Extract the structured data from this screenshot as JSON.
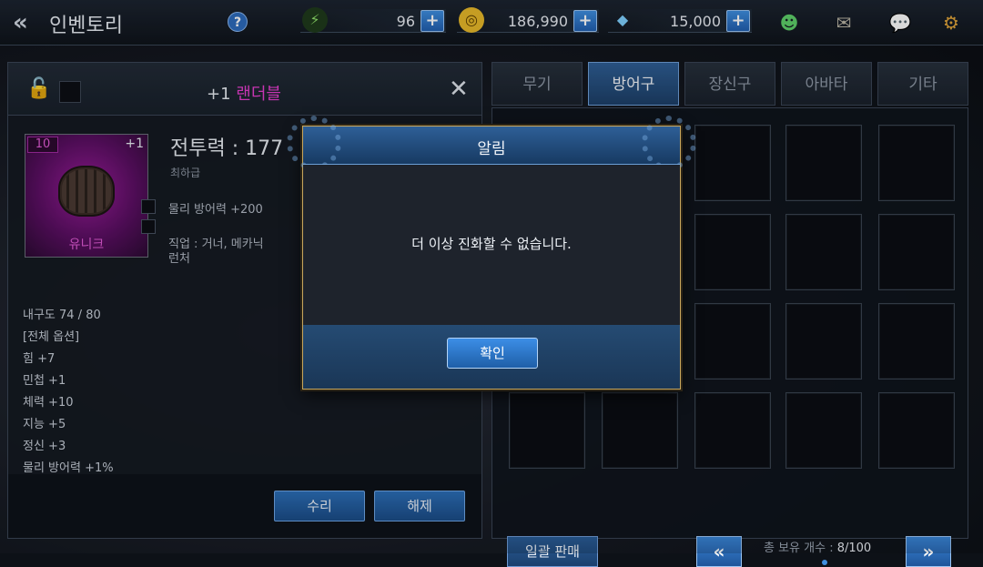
{
  "header": {
    "title": "인벤토리",
    "help": "?",
    "energy": "96",
    "gold": "186,990",
    "gems": "15,000",
    "plus": "+"
  },
  "item_panel": {
    "enhance": "+1",
    "name": "랜더블",
    "level": "10",
    "slot_plus": "+1",
    "rank": "유니크",
    "combat_power": "전투력 : 177",
    "grade": "최하급",
    "stat": "물리 방어력 +200",
    "job": "직업 : 거너, 메카닉\n런처",
    "options": [
      "내구도 74 / 80",
      "[전체 옵션]",
      "힘 +7",
      "민첩 +1",
      "체력 +10",
      "지능 +5",
      "정신 +3",
      "물리 방어력 +1%"
    ],
    "repair_label": "수리",
    "unequip_label": "해제"
  },
  "tabs": [
    {
      "label": "무기",
      "active": false
    },
    {
      "label": "방어구",
      "active": true
    },
    {
      "label": "장신구",
      "active": false
    },
    {
      "label": "아바타",
      "active": false
    },
    {
      "label": "기타",
      "active": false
    }
  ],
  "inventory": {
    "bulk_sell": "일괄 판매",
    "count_label": "총 보유 개수 : ",
    "count_value": "8/100"
  },
  "modal": {
    "title": "알림",
    "message": "더 이상 진화할 수 없습니다.",
    "confirm": "확인"
  },
  "colors": {
    "accent_blue": "#2f6fb8",
    "unique_magenta": "#e83fd0",
    "modal_border": "#c9a75c"
  }
}
